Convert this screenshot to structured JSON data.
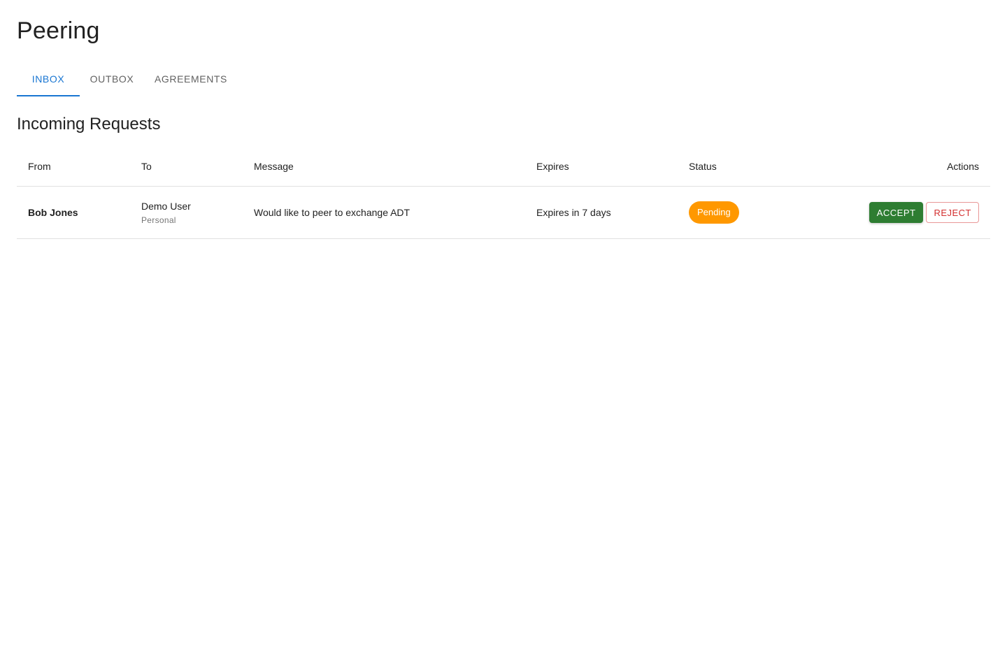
{
  "page": {
    "title": "Peering"
  },
  "tabs": [
    {
      "label": "INBOX",
      "active": true
    },
    {
      "label": "OUTBOX",
      "active": false
    },
    {
      "label": "AGREEMENTS",
      "active": false
    }
  ],
  "section": {
    "title": "Incoming Requests"
  },
  "table": {
    "columns": [
      "From",
      "To",
      "Message",
      "Expires",
      "Status",
      "Actions"
    ],
    "rows": [
      {
        "from": "Bob Jones",
        "to_name": "Demo User",
        "to_type": "Personal",
        "message": "Would like to peer to exchange ADT",
        "expires": "Expires in 7 days",
        "status": "Pending",
        "actions": {
          "accept_label": "ACCEPT",
          "reject_label": "REJECT"
        }
      }
    ]
  },
  "colors": {
    "accent": "#1976d2",
    "status_pending": "#ff9800",
    "accept": "#2e7d32",
    "reject": "#d32f2f"
  }
}
